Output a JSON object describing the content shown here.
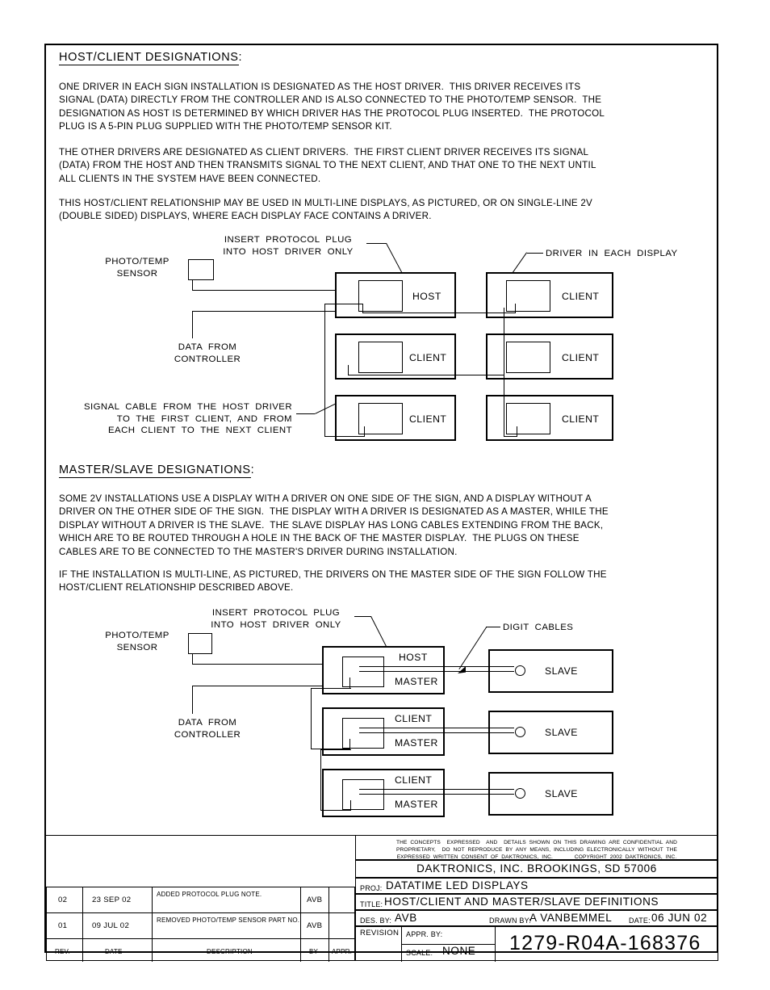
{
  "document": {
    "section1": {
      "heading": "HOST/CLIENT DESIGNATIONS",
      "heading_colon": ":",
      "paragraphs": [
        "ONE DRIVER IN EACH SIGN INSTALLATION IS DESIGNATED AS THE HOST DRIVER.  THIS DRIVER RECEIVES ITS\nSIGNAL (DATA) DIRECTLY FROM THE CONTROLLER AND IS ALSO CONNECTED TO THE PHOTO/TEMP SENSOR.  THE\nDESIGNATION AS HOST IS DETERMINED BY WHICH DRIVER HAS THE PROTOCOL PLUG INSERTED.  THE PROTOCOL\nPLUG IS A 5-PIN PLUG SUPPLIED WITH THE PHOTO/TEMP SENSOR KIT.",
        "THE OTHER DRIVERS ARE DESIGNATED AS CLIENT DRIVERS.  THE FIRST CLIENT DRIVER RECEIVES ITS SIGNAL\n(DATA) FROM THE HOST AND THEN TRANSMITS SIGNAL TO THE NEXT CLIENT, AND THAT ONE TO THE NEXT UNTIL\nALL CLIENTS IN THE SYSTEM HAVE BEEN CONNECTED.",
        "THIS HOST/CLIENT RELATIONSHIP MAY BE USED IN MULTI-LINE DISPLAYS, AS PICTURED, OR ON SINGLE-LINE 2V\n(DOUBLE SIDED) DISPLAYS, WHERE EACH DISPLAY FACE CONTAINS A DRIVER."
      ]
    },
    "section2": {
      "heading": "MASTER/SLAVE DESIGNATIONS",
      "heading_colon": ":",
      "paragraphs": [
        "SOME 2V INSTALLATIONS USE A DISPLAY WITH A DRIVER ON ONE SIDE OF THE SIGN, AND A DISPLAY WITHOUT A\nDRIVER ON THE OTHER SIDE OF THE SIGN.  THE DISPLAY WITH A DRIVER IS DESIGNATED AS A MASTER, WHILE THE\nDISPLAY WITHOUT A DRIVER IS THE SLAVE.  THE SLAVE DISPLAY HAS LONG CABLES EXTENDING FROM THE BACK,\nWHICH ARE TO BE ROUTED THROUGH A HOLE IN THE BACK OF THE MASTER DISPLAY.  THE PLUGS ON THESE\nCABLES ARE TO BE CONNECTED TO THE MASTER'S DRIVER DURING INSTALLATION.",
        "IF THE INSTALLATION IS MULTI-LINE, AS PICTURED, THE DRIVERS ON THE MASTER SIDE OF THE SIGN FOLLOW THE\nHOST/CLIENT RELATIONSHIP DESCRIBED ABOVE."
      ]
    }
  },
  "diagram1": {
    "callouts": {
      "protocol_plug": "INSERT  PROTOCOL  PLUG\nINTO  HOST  DRIVER  ONLY",
      "photo_temp_sensor": "PHOTO/TEMP\nSENSOR",
      "driver_in_each_display": "DRIVER  IN  EACH  DISPLAY",
      "data_from_controller": "DATA  FROM\nCONTROLLER",
      "signal_cable": "SIGNAL  CABLE  FROM  THE  HOST  DRIVER\nTO  THE  FIRST  CLIENT,  AND  FROM\nEACH  CLIENT  TO  THE  NEXT  CLIENT"
    },
    "boxes": [
      {
        "label": "HOST",
        "col": "left",
        "row": 1
      },
      {
        "label": "CLIENT",
        "col": "right",
        "row": 1
      },
      {
        "label": "CLIENT",
        "col": "left",
        "row": 2
      },
      {
        "label": "CLIENT",
        "col": "right",
        "row": 2
      },
      {
        "label": "CLIENT",
        "col": "left",
        "row": 3
      },
      {
        "label": "CLIENT",
        "col": "right",
        "row": 3
      }
    ]
  },
  "diagram2": {
    "callouts": {
      "protocol_plug": "INSERT  PROTOCOL  PLUG\nINTO  HOST  DRIVER  ONLY",
      "photo_temp_sensor": "PHOTO/TEMP\nSENSOR",
      "digit_cables": "DIGIT  CABLES",
      "data_from_controller": "DATA  FROM\nCONTROLLER"
    },
    "rows": [
      {
        "top": "HOST",
        "bottom": "MASTER",
        "slave": "SLAVE"
      },
      {
        "top": "CLIENT",
        "bottom": "MASTER",
        "slave": "SLAVE"
      },
      {
        "top": "CLIENT",
        "bottom": "MASTER",
        "slave": "SLAVE"
      }
    ]
  },
  "title_block": {
    "confidential_notice": "THE  CONCEPTS    EXPRESSED    AND    DETAILS  SHOWN  ON  THIS  DRAWING  ARE  CONFIDENTIAL  AND\nPROPRIETARY,    DO  NOT  REPRODUCE  BY  ANY  MEANS,  INCLUDING  ELECTRONICALLY  WITHOUT  THE\nEXPRESSED  WRITTEN  CONSENT  OF  DAKTRONICS,  INC.              COPYRIGHT  2002  DAKTRONICS,  INC.",
    "company": "DAKTRONICS,  INC.    BROOKINGS,  SD  57006",
    "proj_label": "PROJ:",
    "proj_value": "DATATIME  LED  DISPLAYS",
    "title_label": "TITLE:",
    "title_value": "HOST/CLIENT  AND  MASTER/SLAVE  DEFINITIONS",
    "des_by_label": "DES. BY:",
    "des_by_value": "AVB",
    "drawn_by_label": "DRAWN BY:",
    "drawn_by_value": "A  VANBEMMEL",
    "date_label": "DATE:",
    "date_value": "06  JUN  02",
    "revision_label": "REVISION",
    "appr_by_label": "APPR. BY:",
    "appr_by_value": "",
    "scale_label": "SCALE:",
    "scale_value": "NONE",
    "drawing_number": "1279-R04A-168376"
  },
  "revision_table": {
    "headers": {
      "rev": "REV.",
      "date": "DATE",
      "description": "DESCRIPTION",
      "by": "BY",
      "appr": "APPR."
    },
    "rows": [
      {
        "rev": "02",
        "date": "23  SEP  02",
        "description": "ADDED  PROTOCOL  PLUG  NOTE.",
        "by": "AVB",
        "appr": ""
      },
      {
        "rev": "01",
        "date": "09  JUL  02",
        "description": "REMOVED  PHOTO/TEMP  SENSOR  PART  NO.",
        "by": "AVB",
        "appr": ""
      }
    ]
  }
}
